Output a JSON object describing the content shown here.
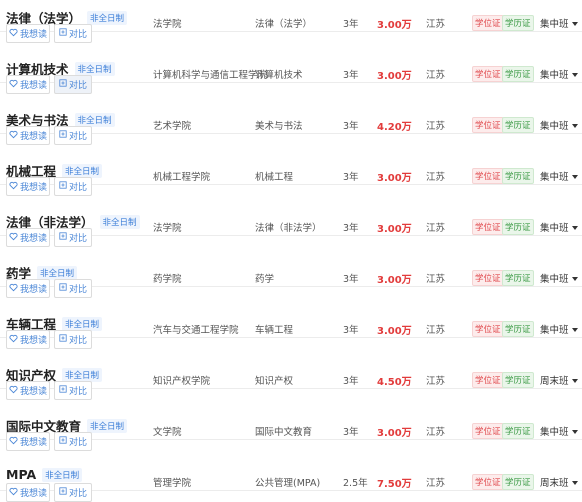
{
  "labels": {
    "want": "我想读",
    "compare": "对比"
  },
  "programs": [
    {
      "name": "法律（法学）",
      "tag": "非全日制",
      "college": "法学院",
      "major": "法律（法学）",
      "years": "3年",
      "price": "3.00万",
      "province": "江苏",
      "degree": "学位证",
      "edu": "学历证",
      "mode": "集中班"
    },
    {
      "name": "计算机技术",
      "tag": "非全日制",
      "college": "计算机科学与通信工程学院",
      "major": "计算机技术",
      "years": "3年",
      "price": "3.00万",
      "province": "江苏",
      "degree": "学位证",
      "edu": "学历证",
      "mode": "集中班",
      "compare_active": true
    },
    {
      "name": "美术与书法",
      "tag": "非全日制",
      "college": "艺术学院",
      "major": "美术与书法",
      "years": "3年",
      "price": "4.20万",
      "province": "江苏",
      "degree": "学位证",
      "edu": "学历证",
      "mode": "集中班"
    },
    {
      "name": "机械工程",
      "tag": "非全日制",
      "college": "机械工程学院",
      "major": "机械工程",
      "years": "3年",
      "price": "3.00万",
      "province": "江苏",
      "degree": "学位证",
      "edu": "学历证",
      "mode": "集中班"
    },
    {
      "name": "法律（非法学）",
      "tag": "非全日制",
      "college": "法学院",
      "major": "法律（非法学）",
      "years": "3年",
      "price": "3.00万",
      "province": "江苏",
      "degree": "学位证",
      "edu": "学历证",
      "mode": "集中班"
    },
    {
      "name": "药学",
      "tag": "非全日制",
      "college": "药学院",
      "major": "药学",
      "years": "3年",
      "price": "3.00万",
      "province": "江苏",
      "degree": "学位证",
      "edu": "学历证",
      "mode": "集中班"
    },
    {
      "name": "车辆工程",
      "tag": "非全日制",
      "college": "汽车与交通工程学院",
      "major": "车辆工程",
      "years": "3年",
      "price": "3.00万",
      "province": "江苏",
      "degree": "学位证",
      "edu": "学历证",
      "mode": "集中班"
    },
    {
      "name": "知识产权",
      "tag": "非全日制",
      "college": "知识产权学院",
      "major": "知识产权",
      "years": "3年",
      "price": "4.50万",
      "province": "江苏",
      "degree": "学位证",
      "edu": "学历证",
      "mode": "周末班"
    },
    {
      "name": "国际中文教育",
      "tag": "非全日制",
      "college": "文学院",
      "major": "国际中文教育",
      "years": "3年",
      "price": "3.00万",
      "province": "江苏",
      "degree": "学位证",
      "edu": "学历证",
      "mode": "集中班"
    },
    {
      "name": "MPA",
      "tag": "非全日制",
      "college": "管理学院",
      "major": "公共管理(MPA)",
      "years": "2.5年",
      "price": "7.50万",
      "province": "江苏",
      "degree": "学位证",
      "edu": "学历证",
      "mode": "周末班"
    }
  ],
  "colors": {
    "price": "#e23b3b",
    "link": "#4a86d6",
    "degree": "#e0494d",
    "edu": "#3c9a46"
  }
}
